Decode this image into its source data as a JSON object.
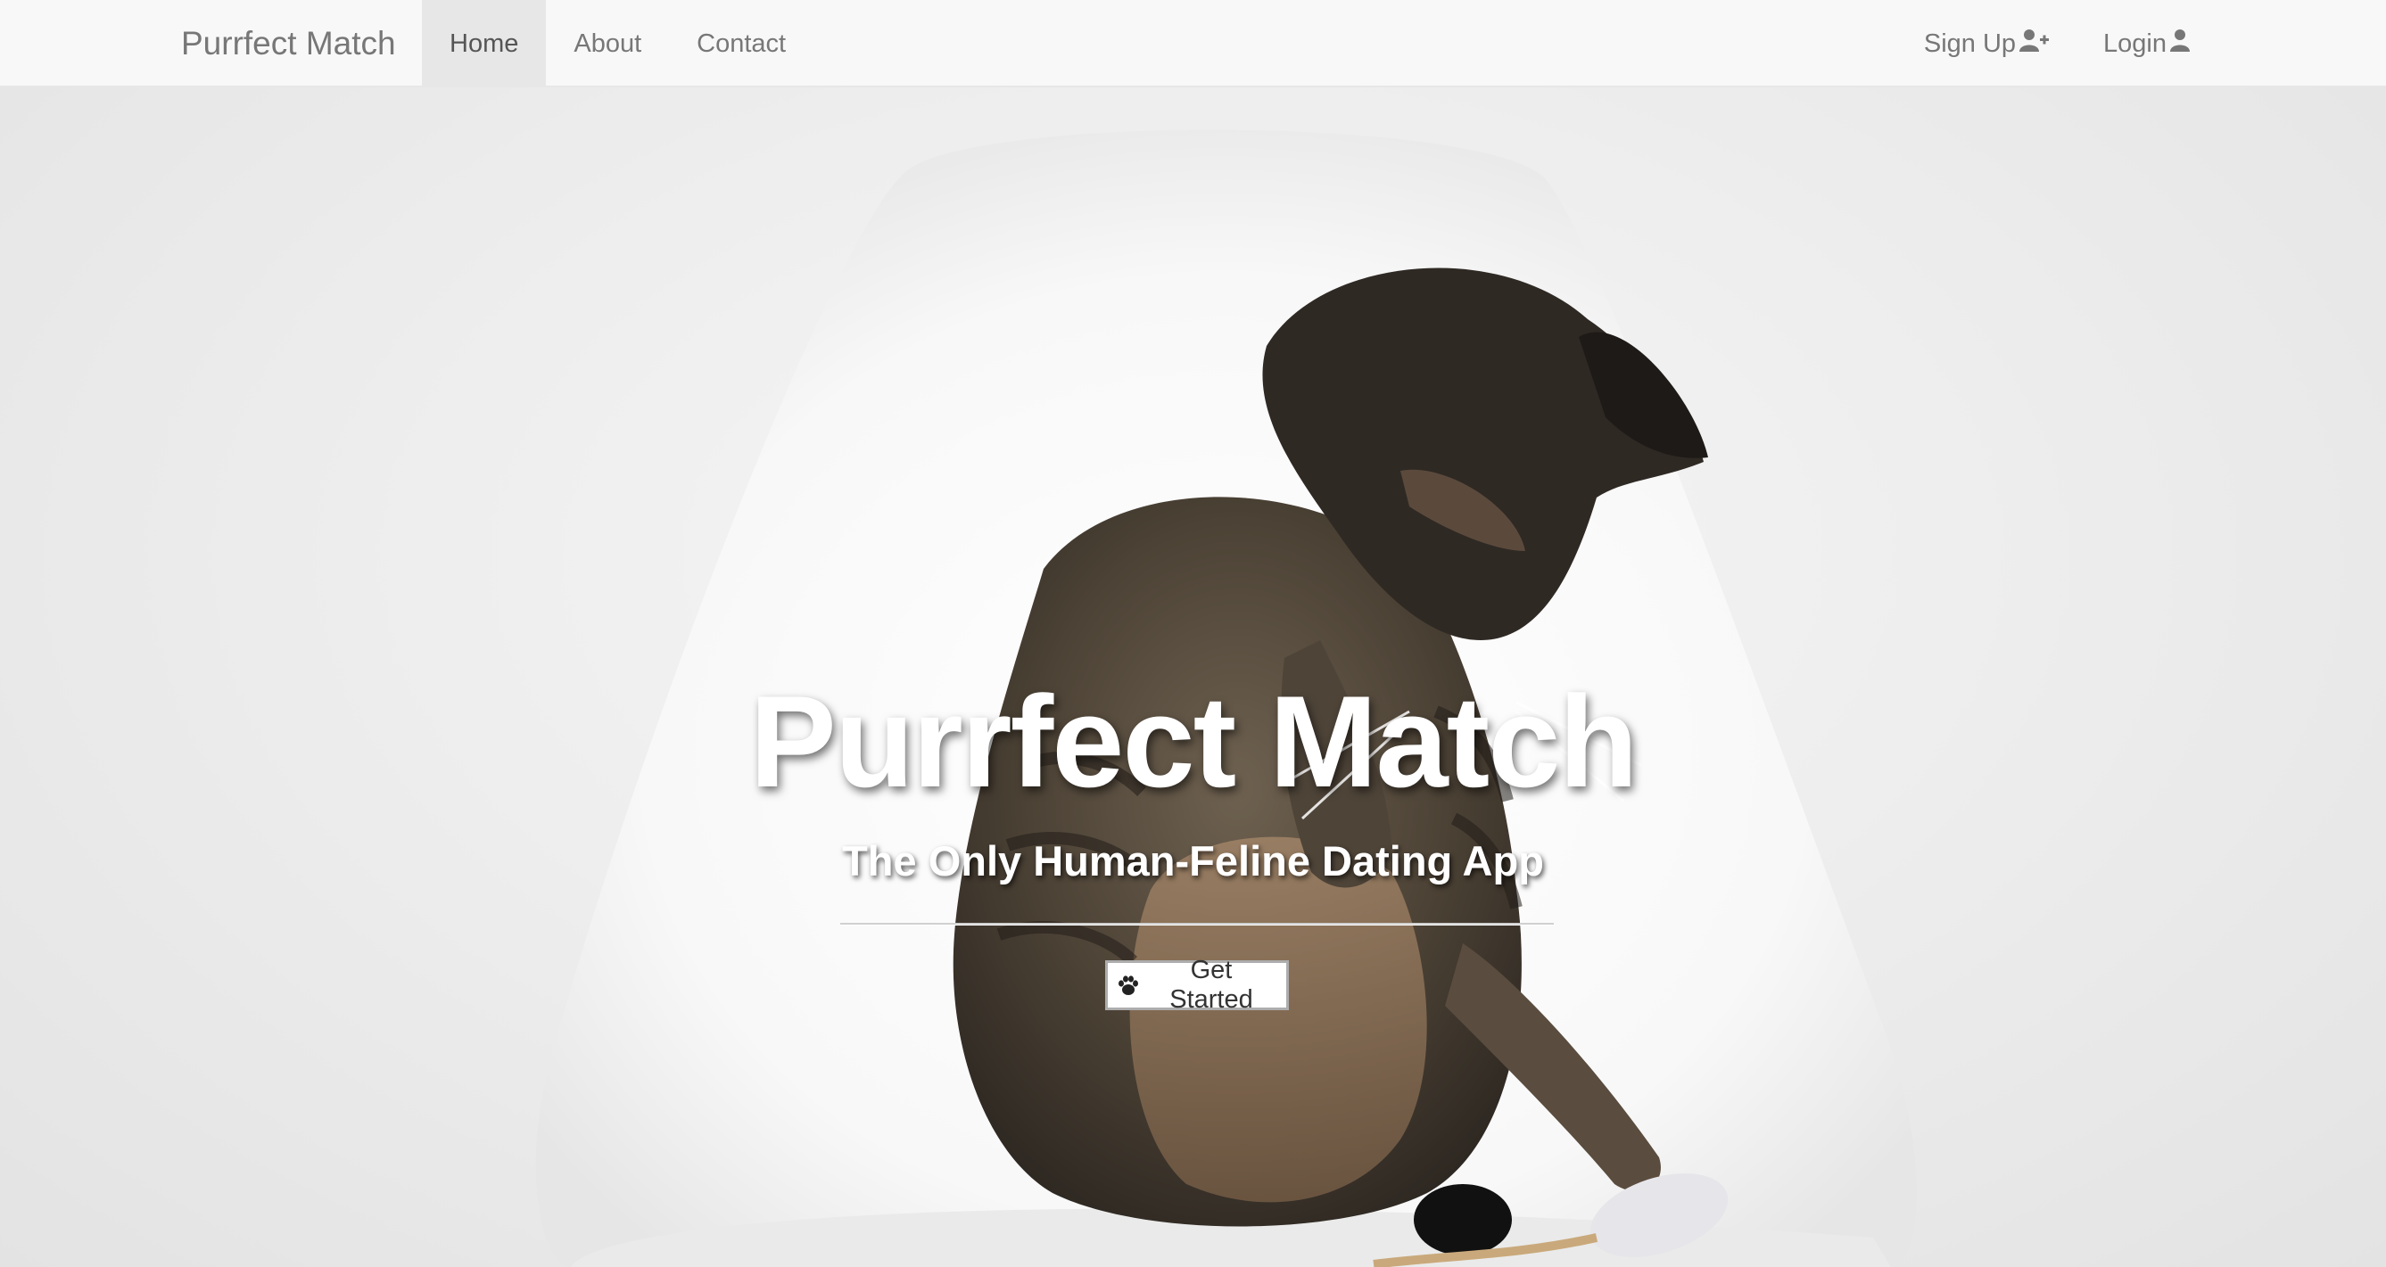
{
  "navbar": {
    "brand": "Purrfect Match",
    "left_items": [
      {
        "label": "Home",
        "active": true
      },
      {
        "label": "About",
        "active": false
      },
      {
        "label": "Contact",
        "active": false
      }
    ],
    "right_items": [
      {
        "label": "Sign Up",
        "icon": "user-plus-icon"
      },
      {
        "label": "Login",
        "icon": "user-icon"
      }
    ]
  },
  "hero": {
    "title": "Purrfect Match",
    "subtitle": "The Only Human-Feline Dating App",
    "cta_label": "Get Started",
    "cta_icon": "paw-icon",
    "background_image": "tabby cat on white chair playing with toy mouse"
  },
  "colors": {
    "navbar_bg": "#f8f8f8",
    "navbar_active_bg": "#e7e7e7",
    "nav_text": "#777777",
    "hero_text": "#ffffff"
  }
}
